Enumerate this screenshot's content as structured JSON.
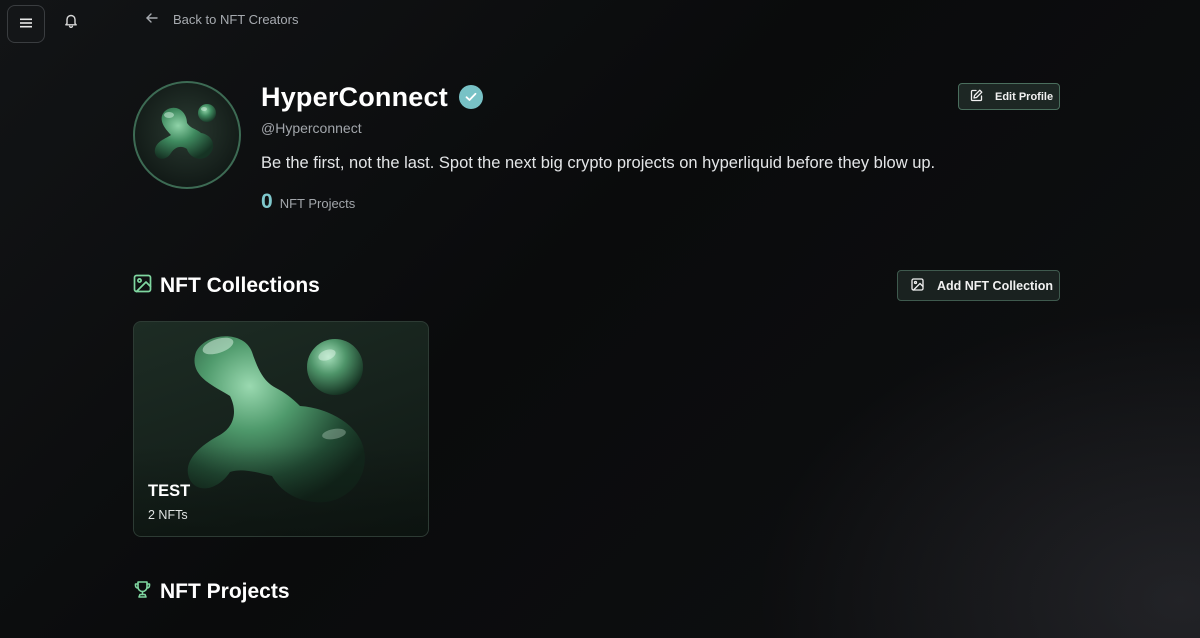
{
  "topbar": {
    "menu_icon": "hamburger-menu-icon",
    "notification_icon": "bell-icon",
    "back_icon": "arrow-left-icon",
    "back_label": "Back to NFT Creators"
  },
  "profile": {
    "name": "HyperConnect",
    "verified": true,
    "handle": "@Hyperconnect",
    "bio": "Be the first, not the last. Spot the next big crypto projects on hyperliquid before they blow up.",
    "nft_projects_count": "0",
    "nft_projects_label": "NFT Projects",
    "edit_button_label": "Edit Profile"
  },
  "collections": {
    "heading": "NFT Collections",
    "add_button_label": "Add NFT Collection",
    "items": [
      {
        "title": "TEST",
        "subtitle": "2 NFTs"
      }
    ]
  },
  "projects": {
    "heading": "NFT Projects"
  },
  "colors": {
    "accent_teal": "#7fc8cc",
    "button_border": "#4a6e5d",
    "button_bg": "#1d2724",
    "background": "#0a0b0c"
  }
}
